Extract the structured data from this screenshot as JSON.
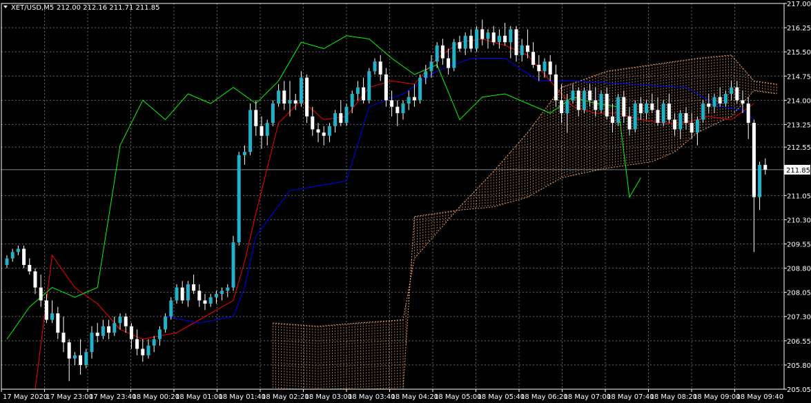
{
  "header": {
    "symbol": "XET/USD,M5",
    "ohlc": "212.00 212.16 211.71 211.85"
  },
  "colors": {
    "background": "#000000",
    "grid": "#c0c0c0",
    "axis": "#ffffff",
    "bull_body": "#20b2c8",
    "bear_body": "#ffffff",
    "wick": "#ffffff",
    "tenkan": "#ff0000",
    "kijun": "#0000ff",
    "chikou": "#00ff00",
    "cloud": "#f4a460",
    "bid_line": "#778899"
  },
  "chart_data": {
    "type": "candlestick",
    "symbol": "XET/USD",
    "timeframe": "M5",
    "indicator": "Ichimoku Kinko Hyo",
    "current_price": 211.85,
    "ylim": [
      205.05,
      217.0
    ],
    "y_ticks": [
      "217.00",
      "216.25",
      "215.50",
      "214.75",
      "214.00",
      "213.25",
      "212.55",
      "211.85",
      "211.05",
      "210.30",
      "209.55",
      "208.80",
      "208.05",
      "207.30",
      "206.55",
      "205.80",
      "205.05"
    ],
    "x_ticks": [
      "17 May 2020",
      "17 May 23:00",
      "17 May 23:40",
      "18 May 00:20",
      "18 May 01:00",
      "18 May 01:40",
      "18 May 02:20",
      "18 May 03:00",
      "18 May 03:40",
      "18 May 04:20",
      "18 May 05:00",
      "18 May 05:40",
      "18 May 06:20",
      "18 May 07:00",
      "18 May 07:40",
      "18 May 08:20",
      "18 May 09:00",
      "18 May 09:40"
    ],
    "candles": [
      [
        208.9,
        209.2,
        208.8,
        209.1
      ],
      [
        209.1,
        209.4,
        209.0,
        209.3
      ],
      [
        209.3,
        209.5,
        209.2,
        209.4
      ],
      [
        209.4,
        209.5,
        208.8,
        208.9
      ],
      [
        208.9,
        209.1,
        208.6,
        208.7
      ],
      [
        208.7,
        208.8,
        208.0,
        208.2
      ],
      [
        208.2,
        208.6,
        207.6,
        207.8
      ],
      [
        207.8,
        208.0,
        207.1,
        207.2
      ],
      [
        207.2,
        207.8,
        207.1,
        207.4
      ],
      [
        207.4,
        207.6,
        206.6,
        206.8
      ],
      [
        206.8,
        207.3,
        206.2,
        206.5
      ],
      [
        206.5,
        206.6,
        205.3,
        206.0
      ],
      [
        206.0,
        206.2,
        205.8,
        206.1
      ],
      [
        206.1,
        206.6,
        205.5,
        205.8
      ],
      [
        205.8,
        206.3,
        205.7,
        206.2
      ],
      [
        206.2,
        207.0,
        206.0,
        206.8
      ],
      [
        206.8,
        207.1,
        206.5,
        206.7
      ],
      [
        206.7,
        207.2,
        206.6,
        207.0
      ],
      [
        207.0,
        207.2,
        206.6,
        206.8
      ],
      [
        206.8,
        207.3,
        206.7,
        207.1
      ],
      [
        207.1,
        207.4,
        206.9,
        207.3
      ],
      [
        207.3,
        207.4,
        206.8,
        207.0
      ],
      [
        207.0,
        207.1,
        206.3,
        206.6
      ],
      [
        206.6,
        206.9,
        206.1,
        206.3
      ],
      [
        206.3,
        206.6,
        205.9,
        206.1
      ],
      [
        206.1,
        206.6,
        206.0,
        206.4
      ],
      [
        206.4,
        206.7,
        206.2,
        206.6
      ],
      [
        206.6,
        207.0,
        206.4,
        206.9
      ],
      [
        206.9,
        207.4,
        206.8,
        207.3
      ],
      [
        207.3,
        207.9,
        207.2,
        207.8
      ],
      [
        207.8,
        208.3,
        207.7,
        208.2
      ],
      [
        208.2,
        208.4,
        207.7,
        207.8
      ],
      [
        207.8,
        208.4,
        207.6,
        208.3
      ],
      [
        208.3,
        208.6,
        208.0,
        208.1
      ],
      [
        208.1,
        208.3,
        207.6,
        207.8
      ],
      [
        207.8,
        208.0,
        207.5,
        207.7
      ],
      [
        207.7,
        208.0,
        207.6,
        207.9
      ],
      [
        207.9,
        208.1,
        207.7,
        208.0
      ],
      [
        208.0,
        208.2,
        207.8,
        208.1
      ],
      [
        208.1,
        208.3,
        207.9,
        208.2
      ],
      [
        208.2,
        209.8,
        208.1,
        209.6
      ],
      [
        209.6,
        212.4,
        209.5,
        212.3
      ],
      [
        212.3,
        212.6,
        212.0,
        212.4
      ],
      [
        212.4,
        213.9,
        212.3,
        213.7
      ],
      [
        213.7,
        214.0,
        212.9,
        213.2
      ],
      [
        213.2,
        213.5,
        212.5,
        212.9
      ],
      [
        212.9,
        213.4,
        212.6,
        213.3
      ],
      [
        213.3,
        214.0,
        213.2,
        213.9
      ],
      [
        213.9,
        214.5,
        213.8,
        214.3
      ],
      [
        214.3,
        214.6,
        213.7,
        213.9
      ],
      [
        213.9,
        214.6,
        213.5,
        214.0
      ],
      [
        214.0,
        214.2,
        213.7,
        213.9
      ],
      [
        213.9,
        214.9,
        213.8,
        214.7
      ],
      [
        214.7,
        214.8,
        213.3,
        213.5
      ],
      [
        213.5,
        213.8,
        212.9,
        213.1
      ],
      [
        213.1,
        213.3,
        212.7,
        213.0
      ],
      [
        213.0,
        213.2,
        212.6,
        212.9
      ],
      [
        212.9,
        213.3,
        212.7,
        213.2
      ],
      [
        213.2,
        213.7,
        213.0,
        213.6
      ],
      [
        213.6,
        214.0,
        213.2,
        213.3
      ],
      [
        213.3,
        213.9,
        213.2,
        213.8
      ],
      [
        213.8,
        214.3,
        213.6,
        214.2
      ],
      [
        214.2,
        214.6,
        214.0,
        214.4
      ],
      [
        214.4,
        214.7,
        213.9,
        214.0
      ],
      [
        214.0,
        215.0,
        213.9,
        214.9
      ],
      [
        214.9,
        215.3,
        214.8,
        215.2
      ],
      [
        215.2,
        215.4,
        214.6,
        214.8
      ],
      [
        214.8,
        215.0,
        213.8,
        214.0
      ],
      [
        214.0,
        214.3,
        213.5,
        213.8
      ],
      [
        213.8,
        214.0,
        213.2,
        213.6
      ],
      [
        213.6,
        214.0,
        213.4,
        213.9
      ],
      [
        213.9,
        214.3,
        213.7,
        214.1
      ],
      [
        214.1,
        214.5,
        213.8,
        214.0
      ],
      [
        214.0,
        214.8,
        213.9,
        214.7
      ],
      [
        214.7,
        215.1,
        214.5,
        214.9
      ],
      [
        214.9,
        215.4,
        214.7,
        215.2
      ],
      [
        215.2,
        215.8,
        215.0,
        215.7
      ],
      [
        215.7,
        215.9,
        215.1,
        215.3
      ],
      [
        215.3,
        215.6,
        214.8,
        215.0
      ],
      [
        215.0,
        215.9,
        214.9,
        215.8
      ],
      [
        215.8,
        216.0,
        215.5,
        215.6
      ],
      [
        215.6,
        216.1,
        215.4,
        216.0
      ],
      [
        216.0,
        216.2,
        215.5,
        215.6
      ],
      [
        215.6,
        216.3,
        215.5,
        216.2
      ],
      [
        216.2,
        216.5,
        215.7,
        215.9
      ],
      [
        215.9,
        216.2,
        215.6,
        216.1
      ],
      [
        216.1,
        216.3,
        215.7,
        215.8
      ],
      [
        215.8,
        216.2,
        215.6,
        216.0
      ],
      [
        216.0,
        216.4,
        215.7,
        215.8
      ],
      [
        215.8,
        216.3,
        215.3,
        216.2
      ],
      [
        216.2,
        216.3,
        215.2,
        215.4
      ],
      [
        215.4,
        215.9,
        215.2,
        215.7
      ],
      [
        215.7,
        216.2,
        215.3,
        215.5
      ],
      [
        215.5,
        215.8,
        215.0,
        215.1
      ],
      [
        215.1,
        215.4,
        214.6,
        214.9
      ],
      [
        214.9,
        215.3,
        214.7,
        215.2
      ],
      [
        215.2,
        215.4,
        214.6,
        214.8
      ],
      [
        214.8,
        215.1,
        213.8,
        214.0
      ],
      [
        214.0,
        214.5,
        213.3,
        213.6
      ],
      [
        213.6,
        214.2,
        213.0,
        214.0
      ],
      [
        214.0,
        214.5,
        213.9,
        214.3
      ],
      [
        214.3,
        214.4,
        213.5,
        213.7
      ],
      [
        213.7,
        214.4,
        213.6,
        214.3
      ],
      [
        214.3,
        214.5,
        213.8,
        214.0
      ],
      [
        214.0,
        214.4,
        213.5,
        213.7
      ],
      [
        213.7,
        214.3,
        213.6,
        214.2
      ],
      [
        214.2,
        214.4,
        213.4,
        213.5
      ],
      [
        213.5,
        213.9,
        213.0,
        213.3
      ],
      [
        213.3,
        214.2,
        213.2,
        214.1
      ],
      [
        214.1,
        214.3,
        213.3,
        213.5
      ],
      [
        213.5,
        213.8,
        212.9,
        213.1
      ],
      [
        213.1,
        214.0,
        213.0,
        213.9
      ],
      [
        213.9,
        214.1,
        213.4,
        213.6
      ],
      [
        213.6,
        214.0,
        213.4,
        213.9
      ],
      [
        213.9,
        214.2,
        213.6,
        213.7
      ],
      [
        213.7,
        214.1,
        213.2,
        213.3
      ],
      [
        213.3,
        214.0,
        213.2,
        213.9
      ],
      [
        213.9,
        214.2,
        213.3,
        213.4
      ],
      [
        213.4,
        213.6,
        212.9,
        213.1
      ],
      [
        213.1,
        213.7,
        212.8,
        213.6
      ],
      [
        213.6,
        213.8,
        213.1,
        213.3
      ],
      [
        213.3,
        213.6,
        212.8,
        213.0
      ],
      [
        213.0,
        213.5,
        212.6,
        213.4
      ],
      [
        213.4,
        214.0,
        213.3,
        213.9
      ],
      [
        213.9,
        214.2,
        213.6,
        213.8
      ],
      [
        213.8,
        214.2,
        213.6,
        214.1
      ],
      [
        214.1,
        214.4,
        213.8,
        213.9
      ],
      [
        213.9,
        214.3,
        213.8,
        214.2
      ],
      [
        214.2,
        214.6,
        214.0,
        214.4
      ],
      [
        214.4,
        214.6,
        213.9,
        214.0
      ],
      [
        214.0,
        214.3,
        213.6,
        213.9
      ],
      [
        213.9,
        214.1,
        212.8,
        213.3
      ],
      [
        213.3,
        213.4,
        209.3,
        211.0
      ],
      [
        211.0,
        212.1,
        210.6,
        212.0
      ],
      [
        212.0,
        212.2,
        211.7,
        211.85
      ]
    ],
    "tenkan_sen": [
      [
        0,
        null
      ],
      [
        8,
        209.2
      ],
      [
        12,
        208.2
      ],
      [
        16,
        207.7
      ],
      [
        20,
        206.9
      ],
      [
        24,
        206.6
      ],
      [
        30,
        206.8
      ],
      [
        36,
        207.4
      ],
      [
        40,
        207.8
      ],
      [
        42,
        209.0
      ],
      [
        44,
        210.5
      ],
      [
        48,
        213.3
      ],
      [
        52,
        214.0
      ],
      [
        56,
        213.4
      ],
      [
        60,
        213.5
      ],
      [
        64,
        214.4
      ],
      [
        68,
        214.6
      ],
      [
        72,
        214.5
      ],
      [
        76,
        215.3
      ],
      [
        80,
        215.8
      ],
      [
        84,
        215.9
      ],
      [
        88,
        215.7
      ],
      [
        92,
        215.4
      ],
      [
        96,
        214.6
      ],
      [
        100,
        213.8
      ],
      [
        104,
        213.6
      ],
      [
        108,
        213.6
      ],
      [
        112,
        213.4
      ],
      [
        116,
        213.3
      ],
      [
        120,
        213.3
      ],
      [
        124,
        213.5
      ],
      [
        128,
        213.4
      ],
      [
        132,
        213.9
      ]
    ],
    "kijun_sen": [
      [
        28,
        207.3
      ],
      [
        34,
        207.1
      ],
      [
        40,
        207.3
      ],
      [
        42,
        208.2
      ],
      [
        44,
        209.8
      ],
      [
        50,
        211.2
      ],
      [
        60,
        211.5
      ],
      [
        64,
        213.8
      ],
      [
        70,
        214.2
      ],
      [
        76,
        214.9
      ],
      [
        82,
        215.3
      ],
      [
        88,
        215.3
      ],
      [
        94,
        214.6
      ],
      [
        100,
        214.6
      ],
      [
        110,
        214.5
      ],
      [
        120,
        214.4
      ],
      [
        126,
        213.8
      ],
      [
        130,
        213.7
      ],
      [
        132,
        213.4
      ]
    ],
    "chikou_span": [
      [
        0,
        206.6
      ],
      [
        4,
        207.6
      ],
      [
        8,
        208.2
      ],
      [
        12,
        207.9
      ],
      [
        16,
        208.2
      ],
      [
        20,
        212.6
      ],
      [
        24,
        214.0
      ],
      [
        28,
        213.4
      ],
      [
        32,
        214.2
      ],
      [
        36,
        213.9
      ],
      [
        40,
        214.4
      ],
      [
        44,
        213.9
      ],
      [
        48,
        214.6
      ],
      [
        52,
        215.8
      ],
      [
        56,
        215.6
      ],
      [
        60,
        216.0
      ],
      [
        64,
        215.9
      ],
      [
        68,
        215.3
      ],
      [
        72,
        214.8
      ],
      [
        76,
        215.1
      ],
      [
        80,
        213.4
      ],
      [
        84,
        214.1
      ],
      [
        88,
        214.2
      ],
      [
        92,
        213.9
      ],
      [
        96,
        213.6
      ],
      [
        100,
        214.1
      ],
      [
        104,
        213.9
      ],
      [
        108,
        213.8
      ],
      [
        110,
        211.0
      ],
      [
        112,
        211.6
      ]
    ],
    "kumo_span_a": [
      [
        47,
        207.1
      ],
      [
        55,
        207.0
      ],
      [
        62,
        207.1
      ],
      [
        70,
        207.2
      ],
      [
        72,
        209.1
      ],
      [
        80,
        210.7
      ],
      [
        86,
        211.8
      ],
      [
        92,
        213.0
      ],
      [
        98,
        214.4
      ],
      [
        106,
        214.9
      ],
      [
        114,
        215.1
      ],
      [
        122,
        215.3
      ],
      [
        128,
        215.4
      ],
      [
        132,
        214.6
      ],
      [
        136,
        214.5
      ]
    ],
    "kumo_span_b": [
      [
        47,
        205.05
      ],
      [
        55,
        205.05
      ],
      [
        62,
        205.05
      ],
      [
        70,
        205.05
      ],
      [
        72,
        210.4
      ],
      [
        80,
        210.6
      ],
      [
        86,
        210.7
      ],
      [
        92,
        211.0
      ],
      [
        98,
        211.6
      ],
      [
        106,
        211.9
      ],
      [
        114,
        212.1
      ],
      [
        118,
        212.4
      ],
      [
        122,
        213.0
      ],
      [
        128,
        213.5
      ],
      [
        132,
        214.3
      ],
      [
        136,
        214.2
      ]
    ]
  }
}
